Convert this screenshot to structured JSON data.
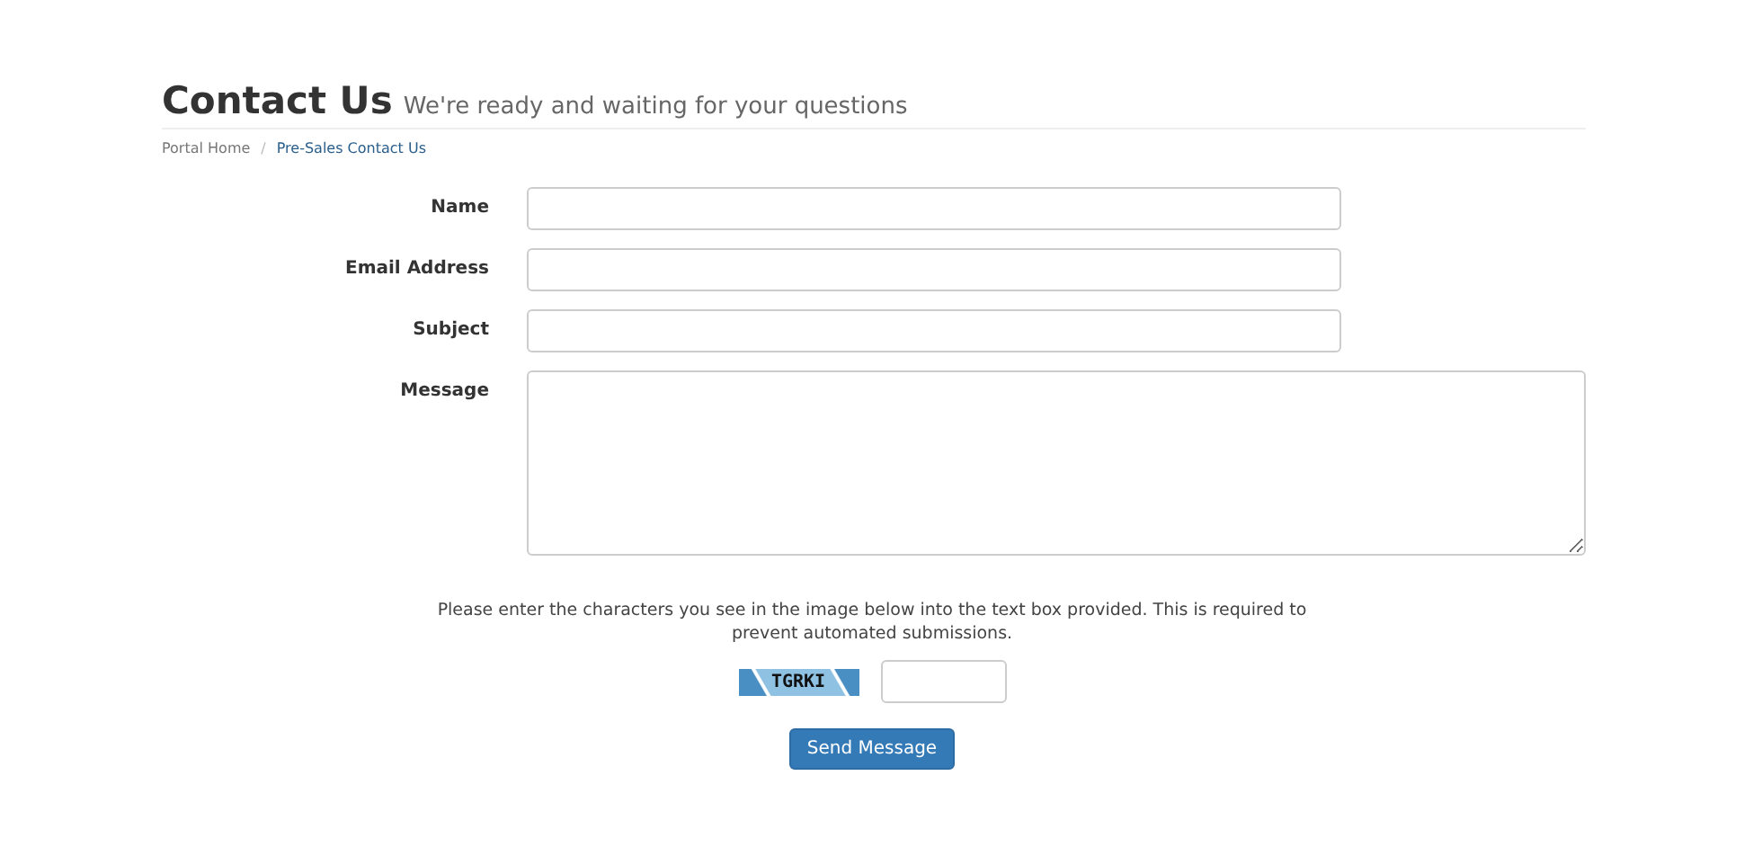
{
  "header": {
    "title": "Contact Us",
    "subtitle": "We're ready and waiting for your questions"
  },
  "breadcrumb": [
    {
      "label": "Portal Home",
      "selected": false
    },
    {
      "label": "Pre-Sales Contact Us",
      "selected": true
    }
  ],
  "breadcrumb_separator": "/",
  "fields": [
    {
      "label": "Name",
      "kind": "input"
    },
    {
      "label": "Email Address",
      "kind": "input"
    },
    {
      "label": "Subject",
      "kind": "input"
    },
    {
      "label": "Message",
      "kind": "textarea"
    }
  ],
  "captcha": {
    "instructions": "Please enter the characters you see in the image below into the text box provided. This is required to prevent automated submissions.",
    "code": "TGRKI"
  },
  "submit": "Send Message"
}
